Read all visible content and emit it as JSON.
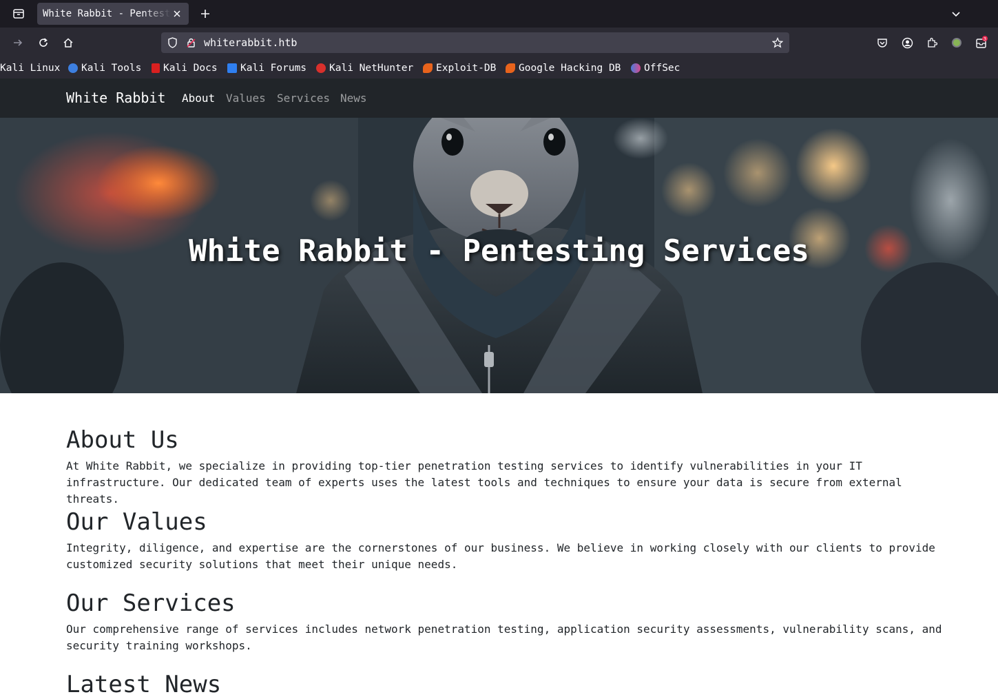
{
  "browser": {
    "tab": {
      "title": "White Rabbit - Pentesting Services"
    },
    "url": "whiterabbit.htb",
    "notification_count": "3",
    "bookmarks": [
      {
        "label": "Kali Linux",
        "icon": "kali-dragon-icon",
        "color": ""
      },
      {
        "label": "Kali Tools",
        "icon": "kali-tools-icon",
        "color": "#3d7fe0"
      },
      {
        "label": "Kali Docs",
        "icon": "kali-docs-icon",
        "color": "#d92020"
      },
      {
        "label": "Kali Forums",
        "icon": "kali-forums-icon",
        "color": "#2f7ff0"
      },
      {
        "label": "Kali NetHunter",
        "icon": "nethunter-icon",
        "color": "#d9302c"
      },
      {
        "label": "Exploit-DB",
        "icon": "exploit-db-icon",
        "color": "#e8631c"
      },
      {
        "label": "Google Hacking DB",
        "icon": "ghdb-icon",
        "color": "#e8631c"
      },
      {
        "label": "OffSec",
        "icon": "offsec-icon",
        "color": "#4a7bd9"
      }
    ]
  },
  "site": {
    "brand": "White Rabbit",
    "nav": [
      {
        "label": "About",
        "active": true
      },
      {
        "label": "Values",
        "active": false
      },
      {
        "label": "Services",
        "active": false
      },
      {
        "label": "News",
        "active": false
      }
    ],
    "hero": {
      "title": "White Rabbit - Pentesting Services",
      "image": "rabbit-in-leather-jacket-image"
    },
    "sections": {
      "about": {
        "heading": "About Us",
        "text": "At White Rabbit, we specialize in providing top-tier penetration testing services to identify vulnerabilities in your IT infrastructure. Our dedicated team of experts uses the latest tools and techniques to ensure your data is secure from external threats."
      },
      "values": {
        "heading": "Our Values",
        "text": "Integrity, diligence, and expertise are the cornerstones of our business. We believe in working closely with our clients to provide customized security solutions that meet their unique needs."
      },
      "services": {
        "heading": "Our Services",
        "text": "Our comprehensive range of services includes network penetration testing, application security assessments, vulnerability scans, and security training workshops."
      },
      "news": {
        "heading": "Latest News"
      }
    }
  }
}
